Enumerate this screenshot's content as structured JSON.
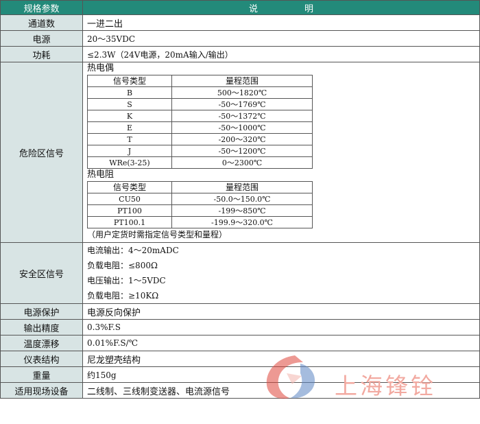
{
  "header": {
    "param": "规格参数",
    "desc_a": "说",
    "desc_b": "明"
  },
  "rows": {
    "channels": {
      "label": "通道数",
      "value": "一进二出"
    },
    "power": {
      "label": "电源",
      "value": "20～35VDC"
    },
    "consumption": {
      "label": "功耗",
      "value": "≤2.3W（24V电源，20mA输入/输出）"
    }
  },
  "hazard": {
    "label": "危险区信号",
    "tc_title": "热电偶",
    "tc_head": [
      "信号类型",
      "量程范围"
    ],
    "tc_rows": [
      [
        "B",
        "500～1820℃"
      ],
      [
        "S",
        "-50～1769℃"
      ],
      [
        "K",
        "-50～1372℃"
      ],
      [
        "E",
        "-50～1000℃"
      ],
      [
        "T",
        "-200～320℃"
      ],
      [
        "J",
        "-50～1200℃"
      ],
      [
        "WRe(3-25)",
        "0～2300℃"
      ]
    ],
    "rtd_title": "热电阻",
    "rtd_head": [
      "信号类型",
      "量程范围"
    ],
    "rtd_rows": [
      [
        "CU50",
        "-50.0～150.0℃"
      ],
      [
        "PT100",
        "-199～850℃"
      ],
      [
        "PT100.1",
        "-199.9～320.0℃"
      ]
    ],
    "note": "（用户定货时需指定信号类型和量程）"
  },
  "safe": {
    "label": "安全区信号",
    "lines": [
      "电流输出：4～20mADC",
      "负载电阻：≤800Ω",
      "电压输出：1～5VDC",
      "负载电阻：≥10KΩ"
    ]
  },
  "rows2": {
    "protect": {
      "label": "电源保护",
      "value": "电源反向保护"
    },
    "accuracy": {
      "label": "输出精度",
      "value": "0.3%F.S"
    },
    "drift": {
      "label": "温度漂移",
      "value": "0.01%F.S/℃"
    },
    "structure": {
      "label": "仪表结构",
      "value": "尼龙塑壳结构"
    },
    "weight": {
      "label": "重量",
      "value": "约150g"
    },
    "devices": {
      "label": "适用现场设备",
      "value": "二线制、三线制变送器、电流源信号"
    }
  },
  "logo": {
    "text": "上海锋铨",
    "color_red": "#e0463c",
    "color_blue": "#5d86c4"
  }
}
